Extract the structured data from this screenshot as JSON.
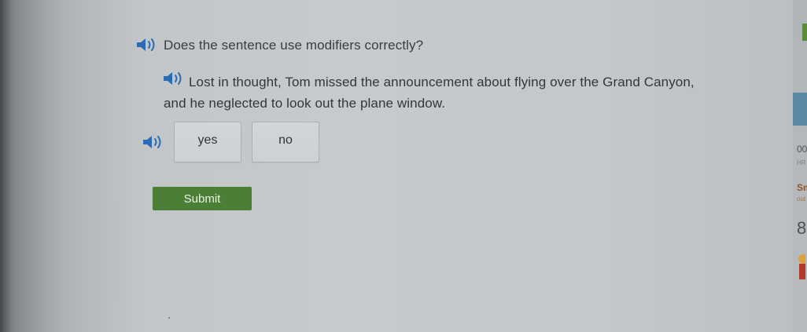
{
  "question": {
    "prompt": "Does the sentence use modifiers correctly?",
    "sentence_line1": "Lost in thought, Tom missed the announcement about flying over the Grand Canyon,",
    "sentence_line2": "and he neglected to look out the plane window."
  },
  "choices": [
    {
      "label": "yes"
    },
    {
      "label": "no"
    }
  ],
  "submit_label": "Submit",
  "side_panel": {
    "time_fragment": "00",
    "time_sub_fragment": "HR",
    "score_label_fragment": "Sm",
    "score_sub_fragment": "out",
    "score_value_fragment": "8"
  },
  "colors": {
    "speaker_icon": "#2a6bb3",
    "submit_bg": "#4c7f36",
    "choice_border": "#a7b3b6",
    "text": "#3a3e42"
  },
  "icons": {
    "speaker": "speaker-icon",
    "ribbon": "award-ribbon-icon"
  }
}
